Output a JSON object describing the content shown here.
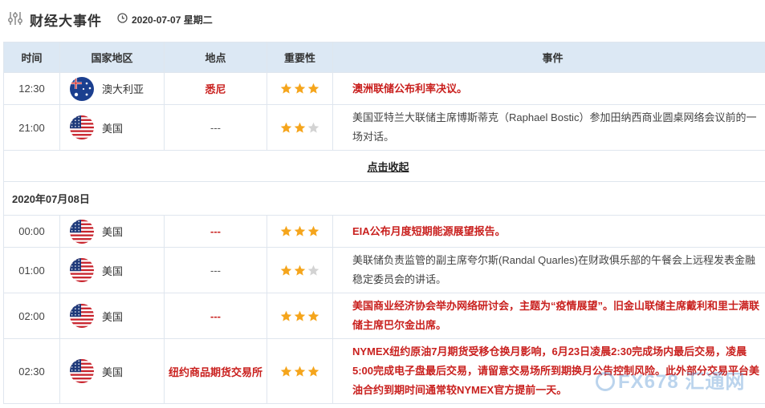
{
  "header": {
    "title": "财经大事件",
    "date": "2020-07-07 星期二"
  },
  "columns": {
    "time": "时间",
    "country": "国家地区",
    "place": "地点",
    "importance": "重要性",
    "event": "事件"
  },
  "day1_rows": [
    {
      "time": "12:30",
      "country": "澳大利亚",
      "flag": "australia-flag",
      "place": "悉尼",
      "place_highlight": true,
      "stars": 3,
      "event": "澳洲联储公布利率决议。",
      "event_highlight": true
    },
    {
      "time": "21:00",
      "country": "美国",
      "flag": "usa-flag",
      "place": "---",
      "place_highlight": false,
      "stars": 2,
      "event": "美国亚特兰大联储主席博斯蒂克（Raphael Bostic）参加田纳西商业圆桌网络会议前的一场对话。",
      "event_highlight": false
    }
  ],
  "collapse_label": "点击收起",
  "day2": {
    "date": "2020年07月08日",
    "rows": [
      {
        "time": "00:00",
        "country": "美国",
        "flag": "usa-flag",
        "place": "---",
        "place_highlight": true,
        "stars": 3,
        "event": "EIA公布月度短期能源展望报告。",
        "event_highlight": true
      },
      {
        "time": "01:00",
        "country": "美国",
        "flag": "usa-flag",
        "place": "---",
        "place_highlight": false,
        "stars": 2,
        "event": "美联储负责监管的副主席夸尔斯(Randal Quarles)在财政俱乐部的午餐会上远程发表金融稳定委员会的讲话。",
        "event_highlight": false
      },
      {
        "time": "02:00",
        "country": "美国",
        "flag": "usa-flag",
        "place": "---",
        "place_highlight": true,
        "stars": 3,
        "event": "美国商业经济协会举办网络研讨会，主题为“疫情展望”。旧金山联储主席戴利和里士满联储主席巴尔金出席。",
        "event_highlight": true
      },
      {
        "time": "02:30",
        "country": "美国",
        "flag": "usa-flag",
        "place": "纽约商品期货交易所",
        "place_highlight": true,
        "stars": 3,
        "event": "NYMEX纽约原油7月期货受移仓换月影响，6月23日凌晨2:30完成场内最后交易，凌晨5:00完成电子盘最后交易，请留意交易场所到期换月公告控制风险。此外部分交易平台美油合约到期时间通常较NYMEX官方提前一天。",
        "event_highlight": true
      }
    ]
  },
  "watermark": "FX678 汇通网",
  "colors": {
    "header_bg": "#dce8f4",
    "border": "#dfe6ee",
    "highlight_red": "#c9201e",
    "star_gold": "#f5a51c",
    "star_gray": "#d3d3d3"
  }
}
